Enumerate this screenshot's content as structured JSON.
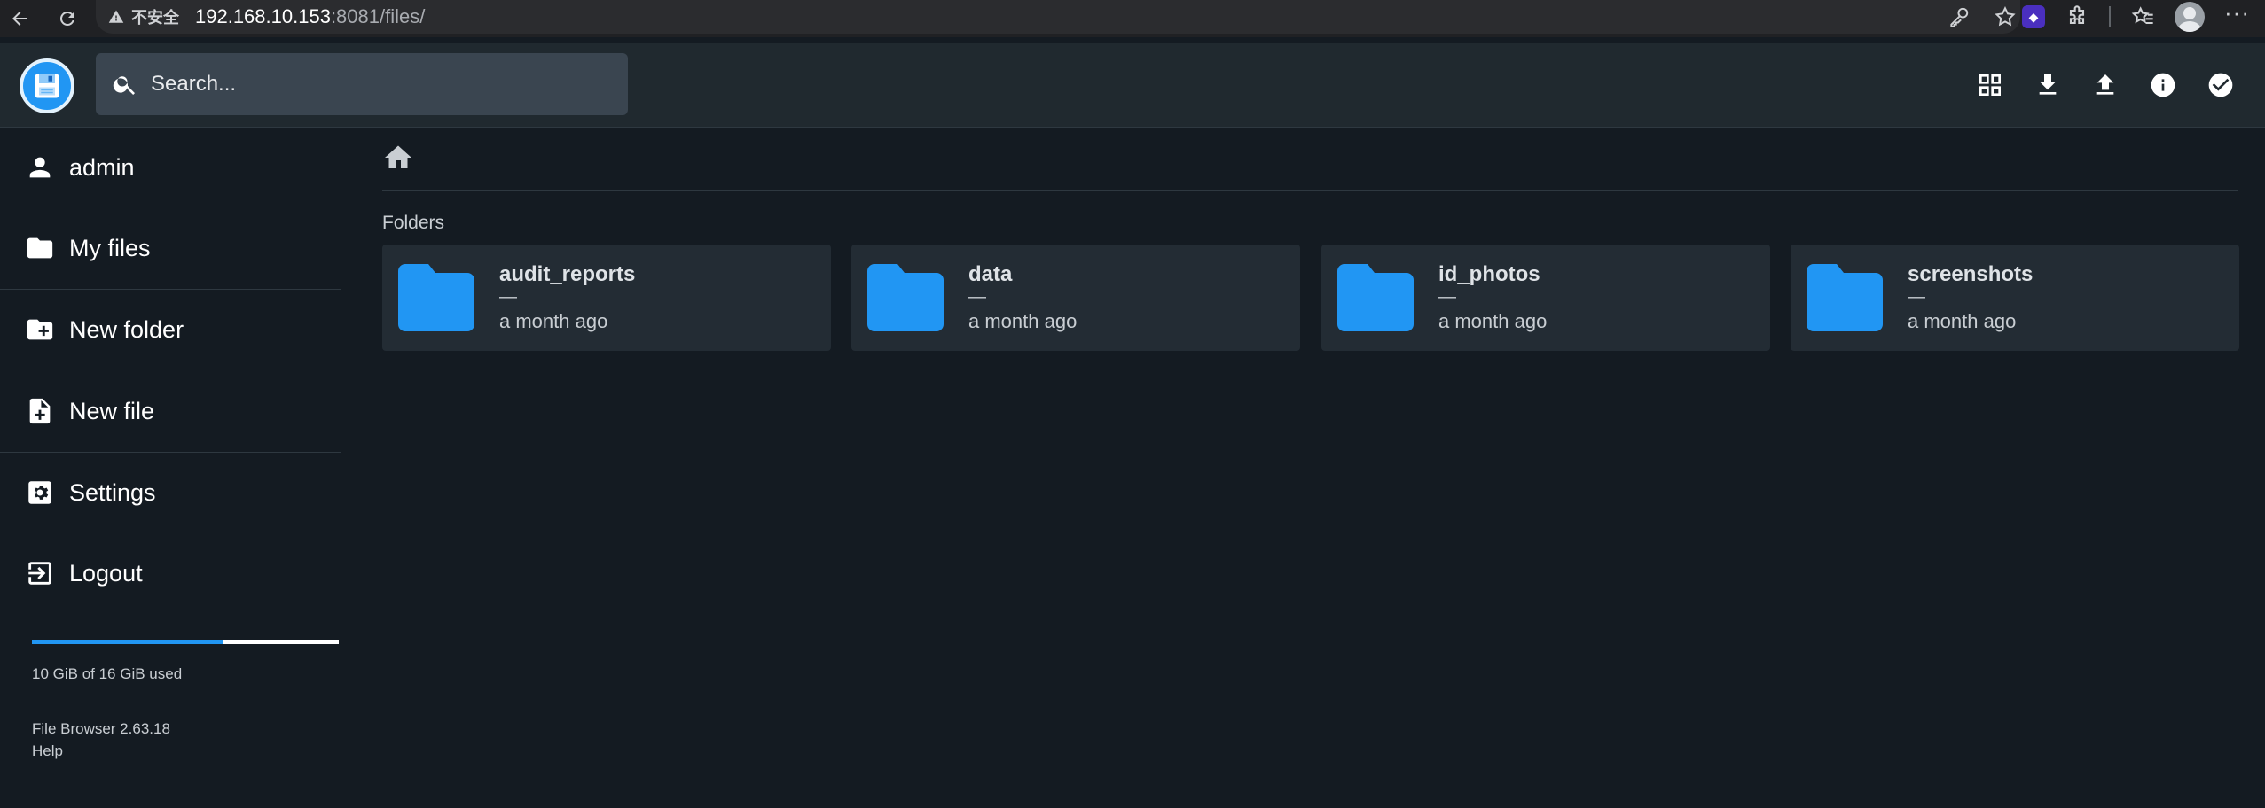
{
  "browser": {
    "insecure_label": "不安全",
    "url_host": "192.168.10.153",
    "url_rest": ":8081/files/"
  },
  "search": {
    "placeholder": "Search..."
  },
  "header_actions": [
    "grid-view-icon",
    "download-icon",
    "upload-icon",
    "info-icon",
    "select-icon"
  ],
  "sidebar": {
    "user": "admin",
    "items": [
      {
        "label": "My files",
        "icon": "folder-icon"
      },
      {
        "label": "New folder",
        "icon": "create-new-folder-icon"
      },
      {
        "label": "New file",
        "icon": "note-add-icon"
      },
      {
        "label": "Settings",
        "icon": "settings-icon"
      },
      {
        "label": "Logout",
        "icon": "exit-icon"
      }
    ],
    "usage": {
      "text": "10 GiB of 16 GiB used",
      "fraction": 0.625
    },
    "footer": {
      "version": "File Browser 2.63.18",
      "help": "Help"
    }
  },
  "main": {
    "section_title": "Folders",
    "folders": [
      {
        "name": "audit_reports",
        "size": "—",
        "modified": "a month ago"
      },
      {
        "name": "data",
        "size": "—",
        "modified": "a month ago"
      },
      {
        "name": "id_photos",
        "size": "—",
        "modified": "a month ago"
      },
      {
        "name": "screenshots",
        "size": "—",
        "modified": "a month ago"
      }
    ]
  },
  "colors": {
    "accent": "#2196f3",
    "folder": "#2196f3",
    "background": "#141b22",
    "header": "#20292f",
    "card": "#232c34"
  }
}
